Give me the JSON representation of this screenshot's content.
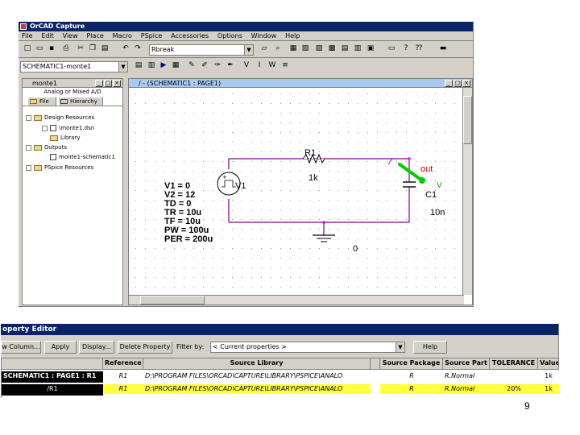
{
  "app": {
    "title": "OrCAD Capture"
  },
  "menu": [
    "File",
    "Edit",
    "View",
    "Place",
    "Macro",
    "PSpice",
    "Accessories",
    "Options",
    "Window",
    "Help"
  ],
  "toolbar": {
    "design_combo": "SCHEMATIC1-monte1",
    "part_combo": "Rbreak"
  },
  "project_window": {
    "title": "monte1",
    "subtitle": "Analog or Mixed A/D",
    "tabs": [
      "File",
      "Hierarchy"
    ],
    "tree": [
      {
        "label": "Design Resources",
        "level": 0,
        "type": "folder"
      },
      {
        "label": "\\monte1.dsn",
        "level": 1,
        "type": "file"
      },
      {
        "label": "Library",
        "level": 1,
        "type": "folder"
      },
      {
        "label": "Outputs",
        "level": 0,
        "type": "folder"
      },
      {
        "label": "monte1-schematic1",
        "level": 1,
        "type": "file"
      },
      {
        "label": "PSpice Resources",
        "level": 0,
        "type": "folder"
      }
    ]
  },
  "schematic_window": {
    "title": "/ - (SCHEMATIC1 : PAGE1)",
    "resistor": {
      "ref": "R1",
      "value": "1k"
    },
    "source": {
      "ref": "V1",
      "params": [
        "V1 = 0",
        "V2 = 12",
        "TD = 0",
        "TR = 10u",
        "TF = 10u",
        "PW = 100u",
        "PER = 200u"
      ]
    },
    "capacitor": {
      "ref": "C1",
      "value": "10n"
    },
    "net_label": "out",
    "probe_label": "V",
    "ground_label": "0"
  },
  "property_editor": {
    "title": "operty Editor",
    "buttons": [
      "w Column...",
      "Apply",
      "Display...",
      "Delete Property"
    ],
    "filter_label": "Filter by:",
    "filter_value": "< Current properties >",
    "help_label": "Help",
    "headers": [
      "",
      "Reference",
      "Source Library",
      "",
      "Source Package",
      "Source Part",
      "TOLERANCE",
      "Value"
    ],
    "rows": [
      [
        "SCHEMATIC1 : PAGE1 : R1",
        "R1",
        "D:\\PROGRAM FILES\\ORCAD\\CAPTURE\\LIBRARY\\PSPICE\\ANALO",
        "",
        "R",
        "R.Normal",
        "",
        "1k"
      ],
      [
        "/R1",
        "R1",
        "D:\\PROGRAM FILES\\ORCAD\\CAPTURE\\LIBRARY\\PSPICE\\ANALO",
        "",
        "R",
        "R.Normal",
        "20%",
        "1k"
      ]
    ]
  },
  "page_number": "9",
  "colors": {
    "wire": "#800080",
    "probe": "#00cc00",
    "highlight_row": "#ffff40",
    "titlebar": "#0a246a"
  }
}
